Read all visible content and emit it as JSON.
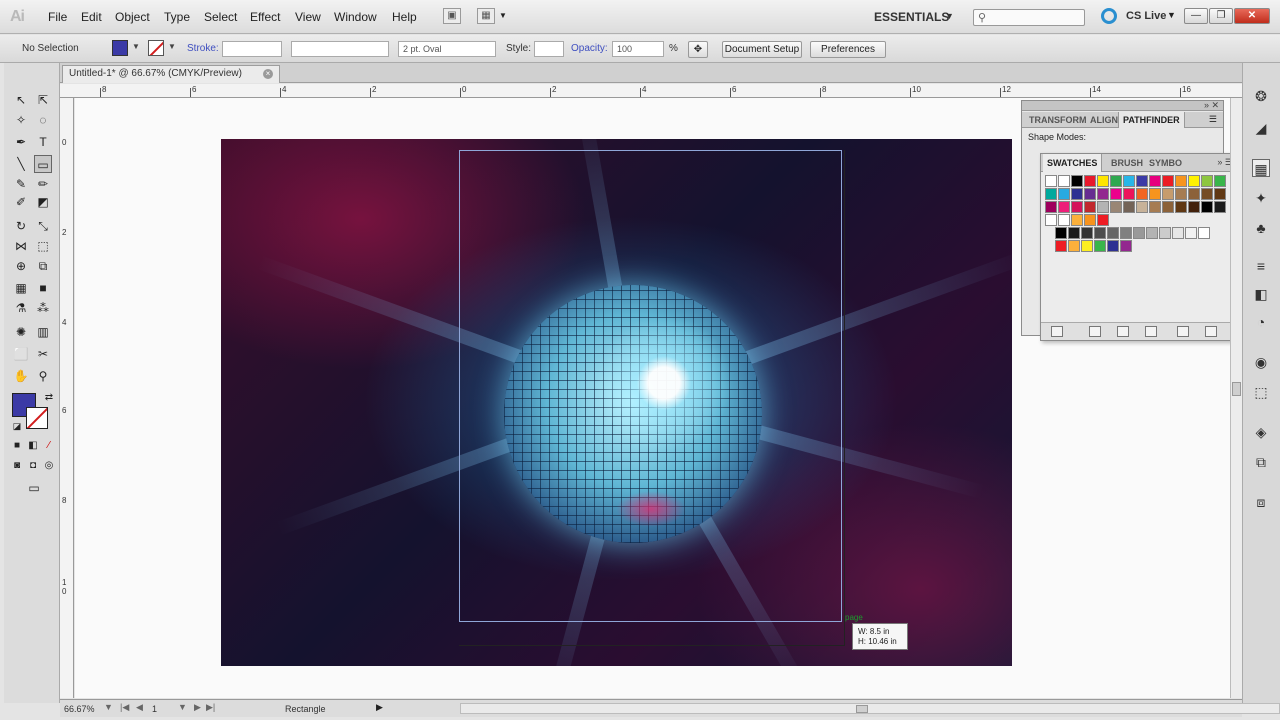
{
  "app": {
    "logo": "Ai"
  },
  "menu": [
    "File",
    "Edit",
    "Object",
    "Type",
    "Select",
    "Effect",
    "View",
    "Window",
    "Help"
  ],
  "workspace": {
    "label": "ESSENTIALS"
  },
  "cslive": {
    "label": "CS Live"
  },
  "window_controls": {
    "minimize": "—",
    "restore": "❐",
    "close": "✕"
  },
  "control_bar": {
    "selection": "No Selection",
    "fill_color": "#3b3aa6",
    "stroke_label": "Stroke:",
    "brush": "2 pt. Oval",
    "style_label": "Style:",
    "opacity_label": "Opacity:",
    "opacity_value": "100",
    "opacity_unit": "%",
    "document_setup": "Document Setup",
    "preferences": "Preferences"
  },
  "document": {
    "tab_title": "Untitled-1* @ 66.67% (CMYK/Preview)",
    "close": "×"
  },
  "ruler": {
    "top": [
      "8",
      "6",
      "4",
      "2",
      "0",
      "2",
      "4",
      "6",
      "8",
      "10",
      "12",
      "14",
      "16"
    ],
    "left": [
      "0",
      "2",
      "4",
      "6",
      "8",
      "1\n0"
    ]
  },
  "canvas": {
    "page_hint": "page",
    "tooltip_w": "W: 8.5 in",
    "tooltip_h": "H: 10.46 in"
  },
  "panels": {
    "pathfinder": {
      "tabs": [
        "TRANSFORM",
        "ALIGN",
        "PATHFINDER"
      ],
      "active_tab": "PATHFINDER",
      "shape_modes_label": "Shape Modes:"
    },
    "swatches": {
      "tabs": [
        "SWATCHES",
        "BRUSH",
        "SYMBO"
      ],
      "active_tab": "SWATCHES",
      "row1": [
        "#ffffff",
        "#ffffff",
        "#000000",
        "#e8192c",
        "#ffe500",
        "#2fa84f",
        "#28b6e8",
        "#3b3aa6",
        "#e6007e",
        "#ec1c24",
        "#f7941d",
        "#fff200",
        "#8dc63f",
        "#39b54a"
      ],
      "row2": [
        "#00a99d",
        "#27aae1",
        "#2e3192",
        "#662d91",
        "#92278f",
        "#ec008c",
        "#ed145b",
        "#f26522",
        "#f7941d",
        "#c69c6d",
        "#a67c52",
        "#8c6239",
        "#754c24",
        "#603813"
      ],
      "row3": [
        "#9e005d",
        "#ed1e79",
        "#d4145a",
        "#c1272d",
        "#b3b3b3",
        "#998675",
        "#736357",
        "#c7b299",
        "#a67c52",
        "#8c6239",
        "#603813",
        "#42210b",
        "#000000",
        "#1a1a1a"
      ],
      "row4": [
        "#ffffff",
        "#ffffff",
        "#fbb03b",
        "#f7931e",
        "#ed1c24"
      ],
      "grays": [
        "#000000",
        "#1a1a1a",
        "#333333",
        "#4d4d4d",
        "#666666",
        "#808080",
        "#999999",
        "#b3b3b3",
        "#cccccc",
        "#e6e6e6",
        "#f2f2f2",
        "#ffffff"
      ],
      "brights": [
        "#ed1c24",
        "#fbb03b",
        "#fcee21",
        "#39b54a",
        "#2e3192",
        "#93278f"
      ]
    }
  },
  "statusbar": {
    "zoom": "66.67%",
    "page": "1",
    "tool": "Rectangle"
  },
  "tools": {
    "fill_color": "#3b3aa6"
  }
}
